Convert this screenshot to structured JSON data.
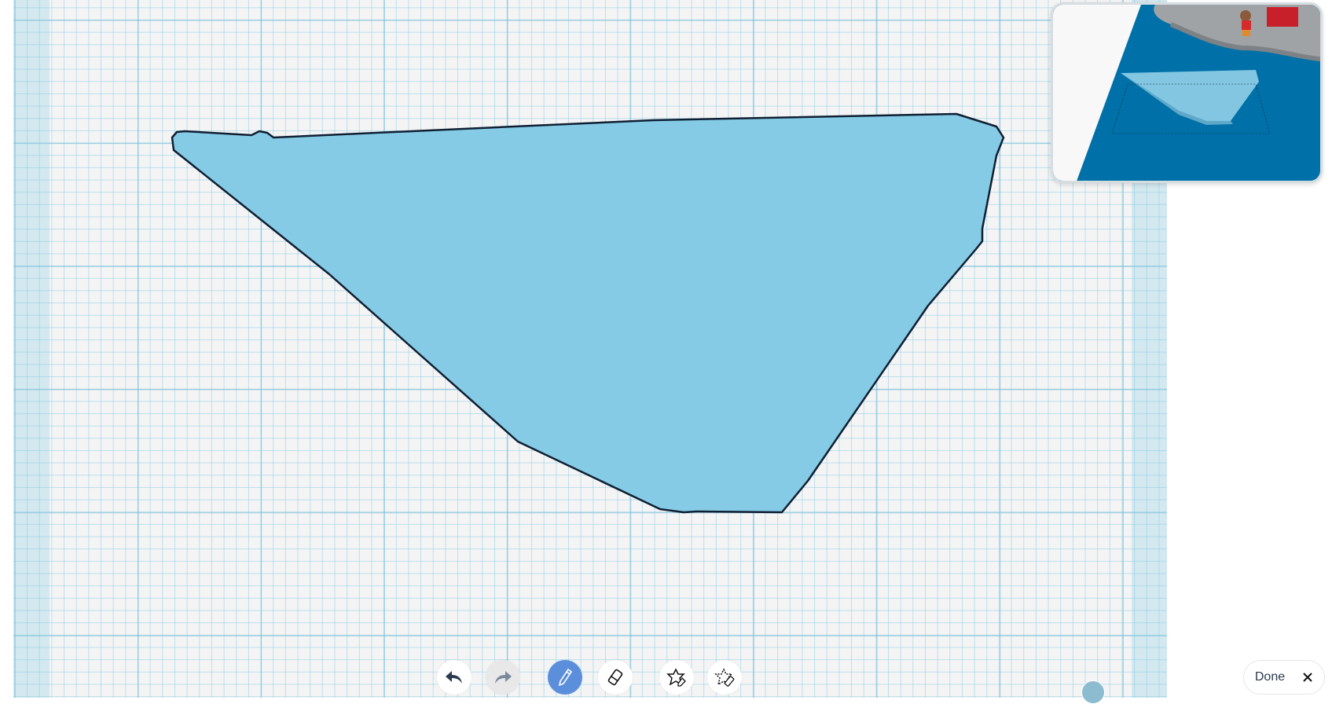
{
  "toolbar": {
    "undo": "undo-icon",
    "redo": "redo-icon",
    "pencil": "pencil-icon",
    "eraser": "eraser-icon",
    "shape_draw": "star-pencil-icon",
    "shape_erase": "star-erase-icon"
  },
  "done_button": {
    "label": "Done"
  },
  "colors": {
    "shape_fill": "#85cbe5",
    "shape_stroke": "#0f1f33",
    "active_tool": "#5b8fdc",
    "preview_bg": "#0070a8"
  }
}
